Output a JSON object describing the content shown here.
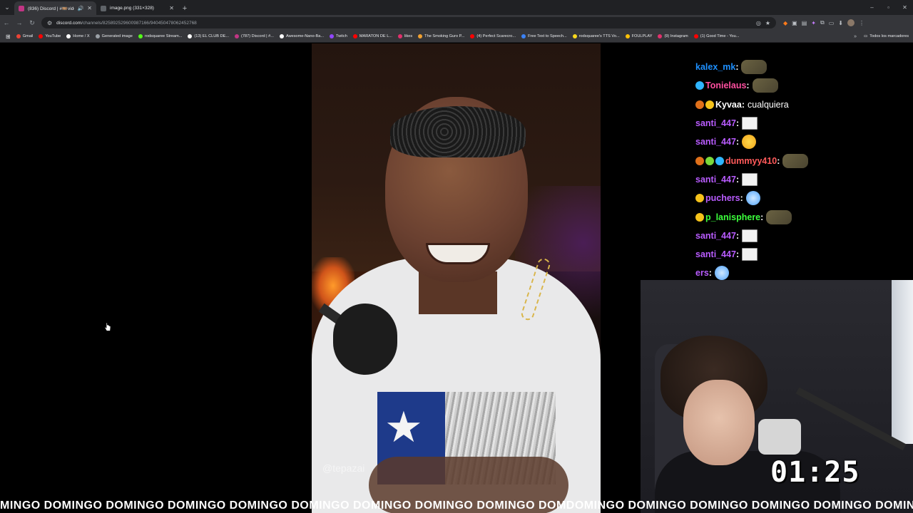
{
  "browser": {
    "tabs": [
      {
        "title": "(836) Discord | #🎞️videos-",
        "active": true,
        "favicon_color": "#c13584"
      },
      {
        "title": "image.png (331×328)",
        "active": false,
        "favicon_color": "#5f6368"
      }
    ],
    "new_tab": "+",
    "window_controls": [
      "–",
      "▫",
      "✕"
    ],
    "url_host": "discord.com",
    "url_path": "/channels/825892529600987166/940450478062452768"
  },
  "bookmarks": [
    {
      "label": "Gmail",
      "color": "#ea4335"
    },
    {
      "label": "YouTube",
      "color": "#ff0000"
    },
    {
      "label": "Home / X",
      "color": "#ffffff"
    },
    {
      "label": "Generated image",
      "color": "#9aa0a6"
    },
    {
      "label": "rodsquaree Stream...",
      "color": "#53fc18"
    },
    {
      "label": "(13) EL CLUB DE...",
      "color": "#ffffff"
    },
    {
      "label": "(787) Discord | #...",
      "color": "#c13584"
    },
    {
      "label": "Awesome-Nano-Ba...",
      "color": "#ffffff"
    },
    {
      "label": "Twitch",
      "color": "#9146ff"
    },
    {
      "label": "MARATON DE L...",
      "color": "#ff0000"
    },
    {
      "label": "likes",
      "color": "#e1306c"
    },
    {
      "label": "The Smoking Guro P...",
      "color": "#f0a030"
    },
    {
      "label": "(4) Perfect Scarecro...",
      "color": "#ff0000"
    },
    {
      "label": "Free Text to Speech...",
      "color": "#3b82f6"
    },
    {
      "label": "rodsquaree's TTS Vo...",
      "color": "#f9d71c"
    },
    {
      "label": "FOULPLAY",
      "color": "#ffc107"
    },
    {
      "label": "(9) Instagram",
      "color": "#e1306c"
    },
    {
      "label": "(1) Good Time - You...",
      "color": "#ff0000"
    }
  ],
  "bookmarks_more": "»",
  "bookmarks_folder": "Todos los marcadores",
  "video": {
    "watermark": "@tepazai"
  },
  "chat": [
    {
      "user": "kalex_mk",
      "color": "#1e90ff",
      "badges": [],
      "text": "",
      "emote": "pepe"
    },
    {
      "user": "Tonielaus",
      "color": "#ff4fa0",
      "badges": [
        "#2fb5ff"
      ],
      "text": "",
      "emote": "pepe"
    },
    {
      "user": "Kyvaa",
      "color": "#ffffff",
      "badges": [
        "#e0701a",
        "#f5c21a"
      ],
      "text": "cualquiera",
      "emote": ""
    },
    {
      "user": "santi_447",
      "color": "#b95cff",
      "badges": [],
      "text": "",
      "emote": "meme"
    },
    {
      "user": "santi_447",
      "color": "#b95cff",
      "badges": [],
      "text": "",
      "emote": "round"
    },
    {
      "user": "dummyy410",
      "color": "#ff5a5a",
      "badges": [
        "#e0701a",
        "#7bd93b",
        "#2fb5ff"
      ],
      "text": "",
      "emote": "pepe"
    },
    {
      "user": "santi_447",
      "color": "#b95cff",
      "badges": [],
      "text": "",
      "emote": "meme"
    },
    {
      "user": "puchers",
      "color": "#b95cff",
      "badges": [
        "#f5c21a"
      ],
      "text": "",
      "emote": "blue"
    },
    {
      "user": "p_lanisphere",
      "color": "#3cff3c",
      "badges": [
        "#f5c21a"
      ],
      "text": "",
      "emote": "pepe"
    },
    {
      "user": "santi_447",
      "color": "#b95cff",
      "badges": [],
      "text": "",
      "emote": "meme"
    },
    {
      "user": "santi_447",
      "color": "#b95cff",
      "badges": [],
      "text": "",
      "emote": "meme"
    },
    {
      "user": "ers",
      "color": "#b95cff",
      "badges": [],
      "text": "",
      "emote": "blue"
    }
  ],
  "timer": "01:25",
  "ticker": "MINGO DOMINGO DOMINGO DOMINGO DOMINGO DOMINGO DOMINGO DOMINGO DOMINGO DOMDOMINGO DOMINGO DOMINGO DOMINGO DOMINGO DOMINGO DOM"
}
